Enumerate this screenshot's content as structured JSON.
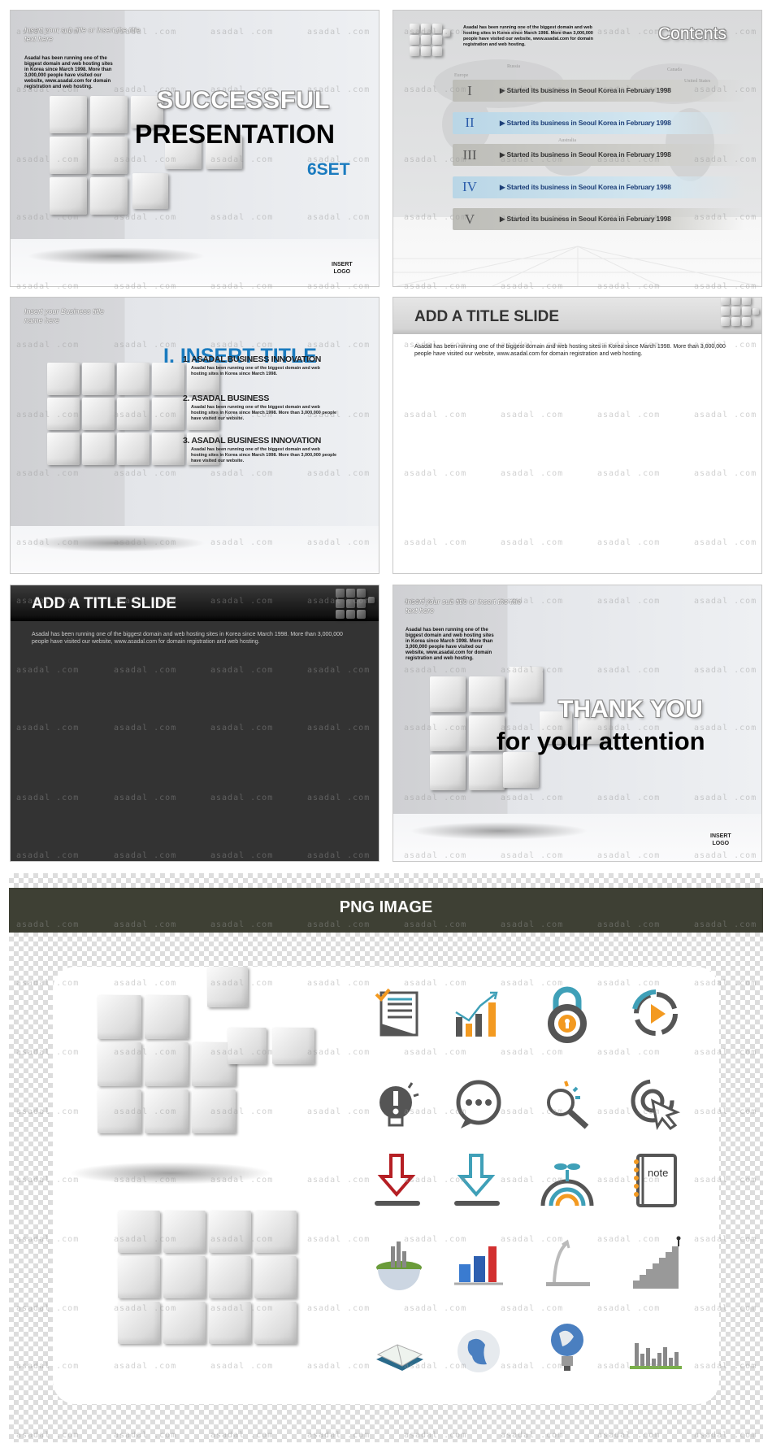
{
  "watermark": "asadal .com",
  "colors": {
    "accent_blue": "#1a7bbf",
    "header_dark": "#3e4034",
    "dark_slide": "#333333"
  },
  "slide1": {
    "subtitle": "Insert your sub title or insert the title text here",
    "paragraph": "Asadal has been running one of the biggest domain and web hosting sites in Korea since March 1998. More than 3,000,000 people have visited our website, www.asadal.com for domain registration and web hosting.",
    "title_line1": "SUCCESSFUL",
    "title_line2": "PRESENTATION",
    "title_line3": "6SET",
    "logo_line1": "INSERT",
    "logo_line2": "LOGO"
  },
  "slide2": {
    "paragraph": "Asadal has been running one of the biggest domain and web hosting sites in Korea since March 1998. More than 3,000,000 people have visited our website, www.asadal.com for domain registration and web hosting.",
    "title": "Contents",
    "map_labels": [
      "Russia",
      "Europe",
      "Canada",
      "United States",
      "Australia"
    ],
    "items": [
      {
        "numeral": "I",
        "text": "▶ Started its business in Seoul Korea in February 1998",
        "style": "gray"
      },
      {
        "numeral": "II",
        "text": "▶ Started its business in Seoul Korea in February 1998",
        "style": "blue"
      },
      {
        "numeral": "III",
        "text": "▶ Started its business in Seoul Korea in February 1998",
        "style": "gray"
      },
      {
        "numeral": "IV",
        "text": "▶ Started its business in Seoul Korea in February 1998",
        "style": "blue"
      },
      {
        "numeral": "V",
        "text": "▶ Started its business in Seoul Korea in February 1998",
        "style": "gray"
      }
    ]
  },
  "slide3": {
    "subtitle": "Insert your Business title name here",
    "title": "I. INSERT TITLE",
    "items": [
      {
        "heading": "1. ASADAL BUSINESS INNOVATION",
        "text": "Asadal has been running one of the biggest domain and web hosting sites in Korea since March 1998."
      },
      {
        "heading": "2. ASADAL BUSINESS",
        "text": "Asadal has been running one of the biggest domain and web hosting sites in Korea since March 1998. More than 3,000,000 people have visited our website."
      },
      {
        "heading": "3. ASADAL BUSINESS INNOVATION",
        "text": "Asadal has been running one of the biggest domain and web hosting sites in Korea since March 1998. More than 3,000,000 people have visited our website."
      }
    ]
  },
  "slide4": {
    "title": "ADD A TITLE SLIDE",
    "paragraph": "Asadal has been running one of the biggest domain and web hosting sites in Korea since March 1998. More than 3,000,000 people have visited our website, www.asadal.com for domain registration and web hosting."
  },
  "slide5": {
    "title": "ADD A TITLE SLIDE",
    "paragraph": "Asadal has been running one of the biggest domain and web hosting sites in Korea since March 1998. More than 3,000,000 people have visited our website, www.asadal.com for domain registration and web hosting."
  },
  "slide6": {
    "subtitle": "Insert your sub title or insert the title text here",
    "paragraph": "Asadal has been running one of the biggest domain and web hosting sites in Korea since March 1998. More than 3,000,000 people have visited our website, www.asadal.com for domain registration and web hosting.",
    "title_line1": "THANK YOU",
    "title_line2": "for your attention",
    "logo_line1": "INSERT",
    "logo_line2": "LOGO"
  },
  "png_section": {
    "header": "PNG IMAGE",
    "note_label": "note",
    "icons": [
      "document-check-icon",
      "bar-chart-growth-icon",
      "padlock-icon",
      "play-circle-icon",
      "lightbulb-alert-icon",
      "chat-bubble-icon",
      "magnifier-icon",
      "cursor-click-icon",
      "download-red-icon",
      "download-blue-icon",
      "sprout-rainbow-icon",
      "notebook-icon",
      "city-globe-icon",
      "3d-bar-chart-icon",
      "arrow-growth-icon",
      "staircase-icon",
      "open-book-icon",
      "globe-icon",
      "globe-lightbulb-icon",
      "city-skyline-icon"
    ]
  }
}
